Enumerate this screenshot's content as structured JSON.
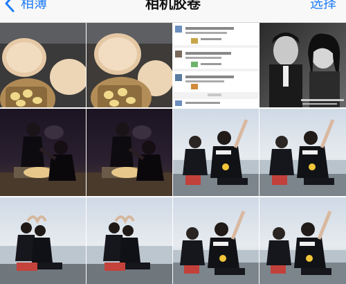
{
  "navbar": {
    "back_label": "相簿",
    "title": "相机胶卷",
    "select_label": "选择"
  },
  "colors": {
    "accent": "#1e7cf5"
  },
  "grid": {
    "photos": [
      {
        "subject": "mooncakes-on-table"
      },
      {
        "subject": "mooncakes-on-table"
      },
      {
        "subject": "chat-screenshot"
      },
      {
        "subject": "black-white-couple-portrait"
      },
      {
        "subject": "couple-at-night"
      },
      {
        "subject": "couple-at-night"
      },
      {
        "subject": "couple-by-sea-peace-sign"
      },
      {
        "subject": "couple-by-sea-peace-sign"
      },
      {
        "subject": "couple-by-sea-heart-gesture"
      },
      {
        "subject": "couple-by-sea-heart-gesture"
      },
      {
        "subject": "couple-by-sea-peace-sign"
      },
      {
        "subject": "couple-by-sea-peace-sign"
      }
    ]
  }
}
